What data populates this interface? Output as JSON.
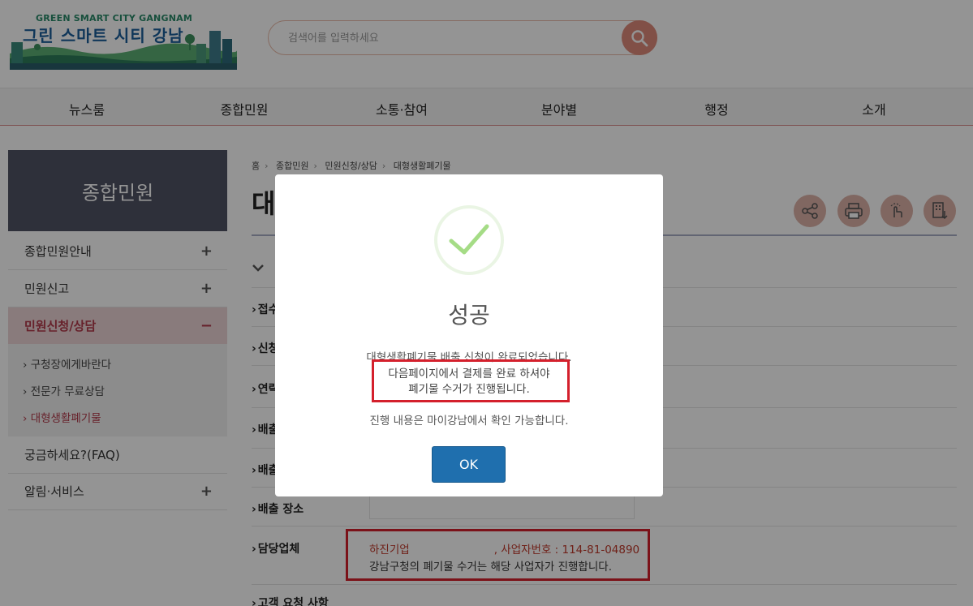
{
  "header": {
    "logo_en": "GREEN SMART CITY GANGNAM",
    "logo_ko": "그린 스마트 시티 강남",
    "search_placeholder": "검색어를 입력하세요"
  },
  "nav": {
    "items": [
      "뉴스룸",
      "종합민원",
      "소통·참여",
      "분야별",
      "행정",
      "소개"
    ]
  },
  "sidebar": {
    "title": "종합민원",
    "items": [
      {
        "label": "종합민원안내",
        "toggle": "+"
      },
      {
        "label": "민원신고",
        "toggle": "+"
      },
      {
        "label": "민원신청/상담",
        "toggle": "−"
      },
      {
        "label": "궁금하세요?(FAQ)",
        "toggle": ""
      },
      {
        "label": "알림·서비스",
        "toggle": "+"
      }
    ],
    "sub_items": [
      "› 구청장에게바란다",
      "› 전문가 무료상담",
      "› 대형생활폐기물"
    ]
  },
  "breadcrumb": [
    "홈",
    "종합민원",
    "민원신청/상담",
    "대형생활폐기물"
  ],
  "page_title": "대",
  "toolbar_icons": [
    "share-icon",
    "print-icon",
    "touch-icon",
    "download-icon"
  ],
  "form": {
    "section_label": "",
    "rows": [
      "접수",
      "신청",
      "연락",
      "배출",
      "배출",
      "배출 장소",
      "담당업체",
      "고객 요청 사항"
    ]
  },
  "vendor": {
    "name": "하진기업",
    "business_no_text": ", 사업자번호 : 114-81-04890",
    "note": "강남구청의 폐기물 수거는 해당 사업자가 진행합니다."
  },
  "modal": {
    "title": "성공",
    "message1": "대형생활폐기물 배출 신청이 완료되었습니다.",
    "message2": "다음페이지에서 결제를 완료 하셔야",
    "message3": "폐기물 수거가 진행됩니다.",
    "message4": "진행 내용은 마이강남에서 확인 가능합니다.",
    "ok_label": "OK"
  },
  "colors": {
    "accent_red": "#d4202c",
    "sidebar_title_bg": "#505364",
    "ok_blue": "#1f6fae",
    "check_green": "#a5dc86"
  }
}
